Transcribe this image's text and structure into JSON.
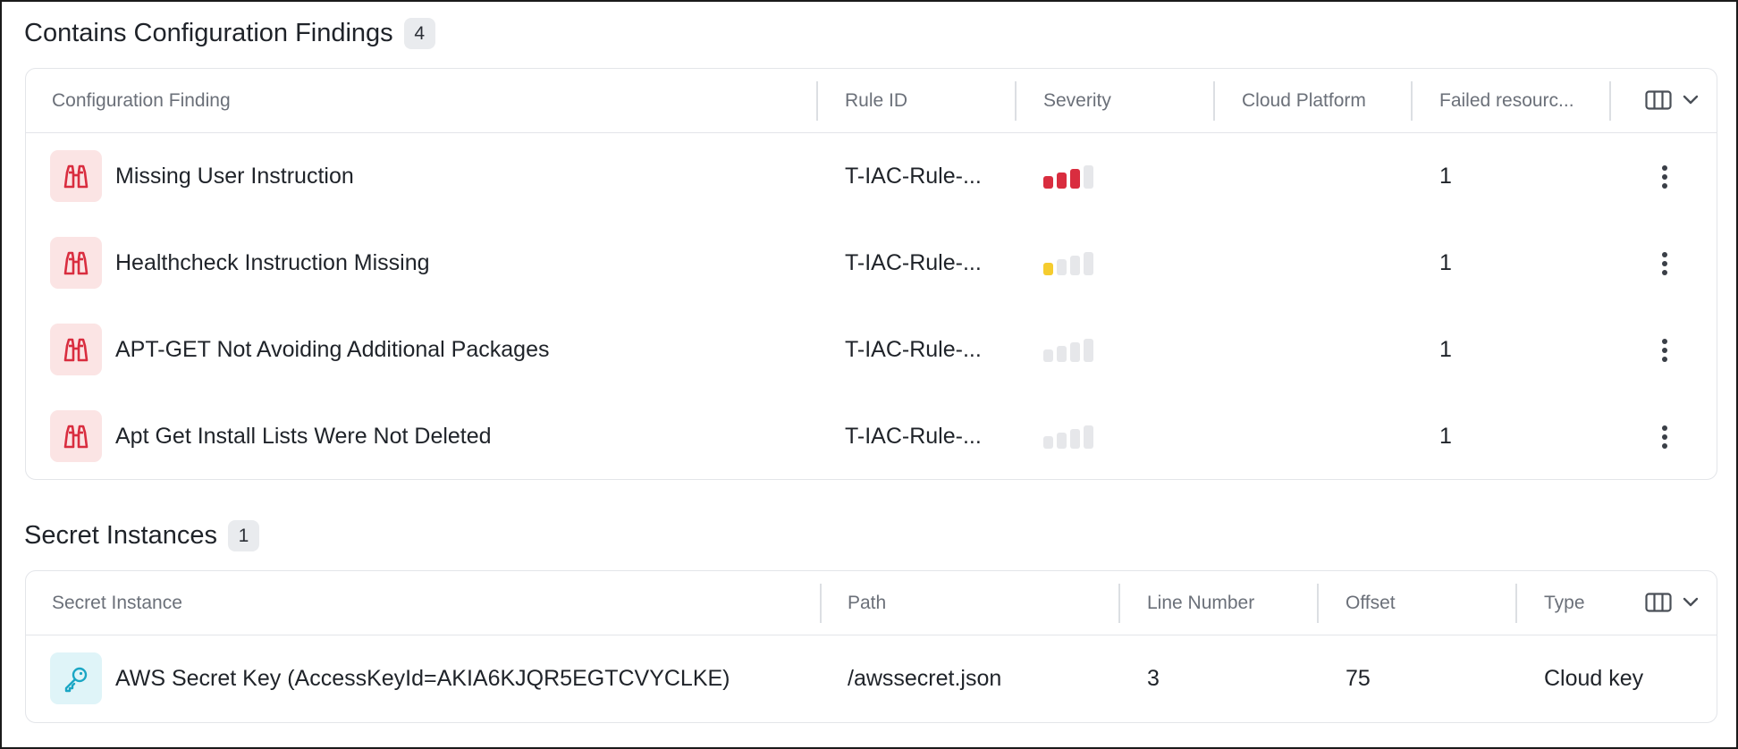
{
  "config_section": {
    "title": "Contains Configuration Findings",
    "count": "4",
    "columns": [
      "Configuration Finding",
      "Rule ID",
      "Severity",
      "Cloud Platform",
      "Failed resourc..."
    ],
    "rows": [
      {
        "icon": "binoculars-icon",
        "name": "Missing User Instruction",
        "rule_id": "T-IAC-Rule-...",
        "severity_level": 3,
        "severity_color": "#d92d3f",
        "cloud_platform": "",
        "failed": "1"
      },
      {
        "icon": "binoculars-icon",
        "name": "Healthcheck Instruction Missing",
        "rule_id": "T-IAC-Rule-...",
        "severity_level": 1,
        "severity_color": "#f5cc2e",
        "cloud_platform": "",
        "failed": "1"
      },
      {
        "icon": "binoculars-icon",
        "name": "APT-GET Not Avoiding Additional Packages",
        "rule_id": "T-IAC-Rule-...",
        "severity_level": 0,
        "severity_color": "#e6e7ea",
        "cloud_platform": "",
        "failed": "1"
      },
      {
        "icon": "binoculars-icon",
        "name": "Apt Get Install Lists Were Not Deleted",
        "rule_id": "T-IAC-Rule-...",
        "severity_level": 0,
        "severity_color": "#e6e7ea",
        "cloud_platform": "",
        "failed": "1"
      }
    ]
  },
  "secret_section": {
    "title": "Secret Instances",
    "count": "1",
    "columns": [
      "Secret Instance",
      "Path",
      "Line Number",
      "Offset",
      "Type"
    ],
    "rows": [
      {
        "icon": "key-icon",
        "name": "AWS Secret Key (AccessKeyId=AKIA6KJQR5EGTCVYCLKE)",
        "path": "/awssecret.json",
        "line": "3",
        "offset": "75",
        "type": "Cloud key"
      }
    ]
  },
  "colors": {
    "accent_red": "#d92d3f",
    "accent_yellow": "#f5cc2e",
    "key_cyan": "#1aa6c4"
  }
}
